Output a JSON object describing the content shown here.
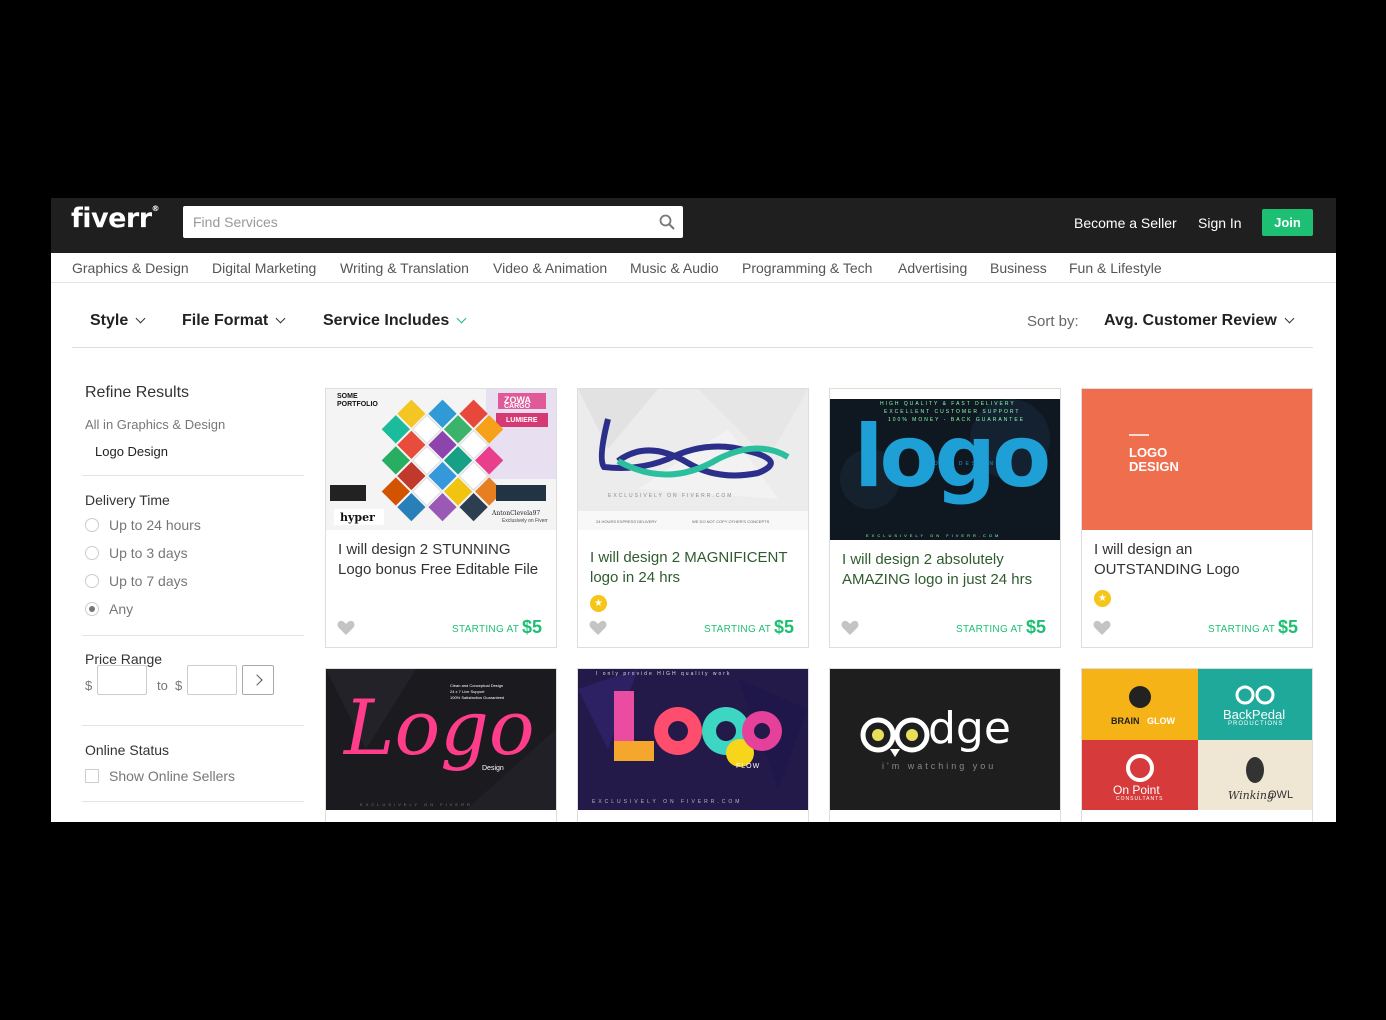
{
  "brand": {
    "logo": "fiverr",
    "reg": "®"
  },
  "search": {
    "placeholder": "Find Services"
  },
  "header": {
    "become_seller": "Become a Seller",
    "sign_in": "Sign In",
    "join": "Join"
  },
  "categories": [
    "Graphics & Design",
    "Digital Marketing",
    "Writing & Translation",
    "Video & Animation",
    "Music & Audio",
    "Programming & Tech",
    "Advertising",
    "Business",
    "Fun & Lifestyle"
  ],
  "filters": {
    "style": "Style",
    "file_format": "File Format",
    "service_includes": "Service Includes",
    "sort_label": "Sort by:",
    "sort_value": "Avg. Customer Review"
  },
  "sidebar": {
    "refine": "Refine Results",
    "all_in": "All in Graphics & Design",
    "current": "Logo Design",
    "delivery_title": "Delivery Time",
    "delivery_options": [
      "Up to 24 hours",
      "Up to 3 days",
      "Up to 7 days",
      "Any"
    ],
    "delivery_selected": "Any",
    "price_title": "Price Range",
    "price_from": "$",
    "price_to": "to",
    "price_to_currency": "$",
    "online_title": "Online Status",
    "online_label": "Show Online Sellers"
  },
  "gigs": [
    {
      "title": "I will design 2 STUNNING Logo bonus Free Editable File",
      "starting": "STARTING AT",
      "price": "$5",
      "badge": false,
      "art": {
        "l1": "SOME",
        "l2": "PORTFOLIO",
        "l3": "ZOWA",
        "l4": "CARGO",
        "l5": "LUMIERE",
        "l6": "hyper",
        "l7": "AntonClevela97",
        "l8": "Exclusively on Fiverr"
      }
    },
    {
      "title": "I will design 2 MAGNIFICENT logo in 24 hrs",
      "starting": "STARTING AT",
      "price": "$5",
      "badge": true,
      "badge_icon": "★",
      "art": {
        "l1": "EXCLUSIVELY ON FIVERR.COM",
        "l2": "24 HOURS EXPRESS DELIVERY",
        "l3": "WE DO NOT COPY OTHER'S CONCEPTS"
      }
    },
    {
      "title": "I will design 2 absolutely AMAZING logo in just 24 hrs",
      "starting": "STARTING AT",
      "price": "$5",
      "badge": false,
      "art": {
        "l1": "HIGH QUALITY & FAST DELIVERY",
        "l2": "EXCELLENT CUSTOMER SUPPORT",
        "l3": "100% MONEY - BACK GUARANTEE",
        "l4": "logo",
        "l5": "LOGO DESIGNS",
        "l6": "EXCLUSIVELY ON FIVERR.COM"
      }
    },
    {
      "title": "I will design an OUTSTANDING Logo",
      "starting": "STARTING AT",
      "price": "$5",
      "badge": true,
      "badge_icon": "★",
      "art": {
        "l1": "LOGO",
        "l2": "DESIGN"
      }
    },
    {
      "art": {
        "l1": "Logo",
        "l2": "Design",
        "l3": "Clean and Conceptual Design",
        "l4": "24 x 7 Live Support",
        "l5": "100% Satisfaction Guaranteed",
        "l6": "EXCLUSIVELY ON FIVERR"
      }
    },
    {
      "art": {
        "l1": "I only provide HIGH quality work",
        "l2": "FLOW",
        "l3": "EXCLUSIVELY ON FIVERR.COM"
      }
    },
    {
      "art": {
        "l1": "dge",
        "l2": "i'm watching you"
      }
    },
    {
      "art": {
        "l1": "BRAIN",
        "l2": "GLOW",
        "l3": "BackPedal",
        "l4": "PRODUCTIONS",
        "l5": "On Point",
        "l6": "CONSULTANTS",
        "l7": "Winking",
        "l8": "OWL"
      }
    }
  ]
}
